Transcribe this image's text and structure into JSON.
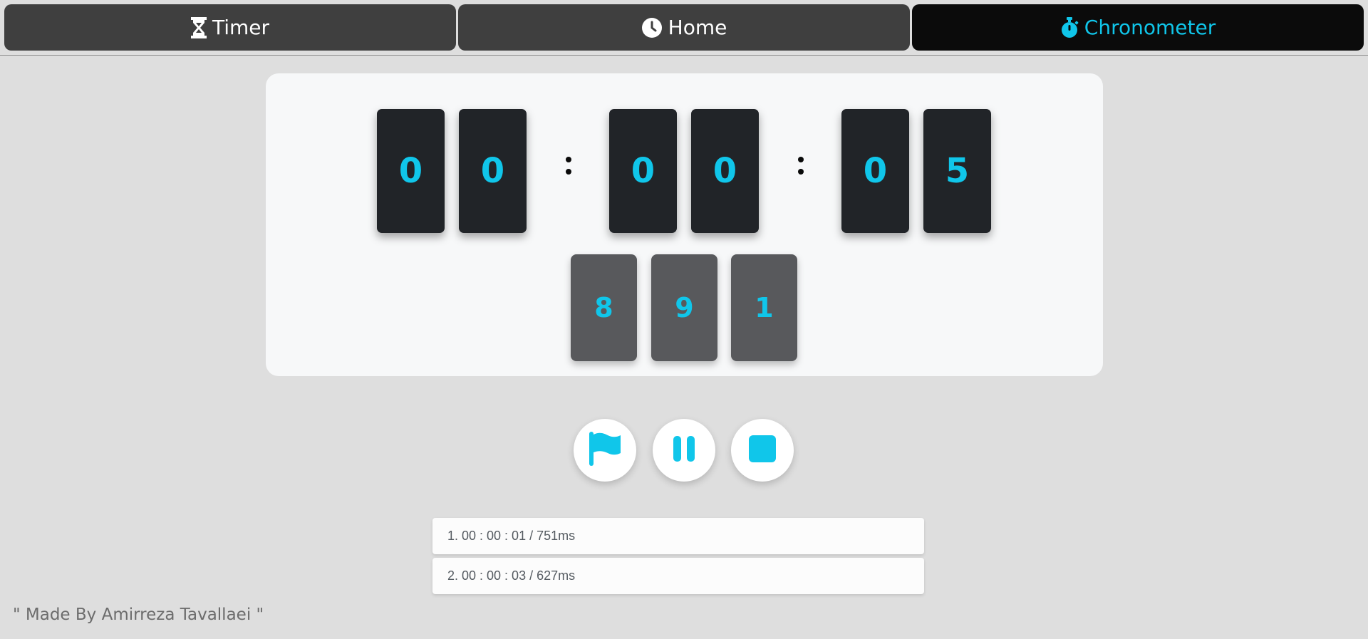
{
  "nav": {
    "tabs": [
      {
        "label": "Timer",
        "icon": "hourglass-icon",
        "active": false
      },
      {
        "label": "Home",
        "icon": "clock-icon",
        "active": false
      },
      {
        "label": "Chronometer",
        "icon": "stopwatch-icon",
        "active": true
      }
    ]
  },
  "display": {
    "hours": [
      "0",
      "0"
    ],
    "minutes": [
      "0",
      "0"
    ],
    "seconds": [
      "0",
      "5"
    ],
    "milliseconds": [
      "8",
      "9",
      "1"
    ]
  },
  "controls": [
    {
      "name": "lap-button",
      "icon": "flag-icon"
    },
    {
      "name": "pause-button",
      "icon": "pause-icon"
    },
    {
      "name": "stop-button",
      "icon": "stop-icon"
    }
  ],
  "laps": [
    "1. 00 : 00 : 01 / 751ms",
    "2. 00 : 00 : 03 / 627ms"
  ],
  "footer": {
    "credit": "\" Made By Amirreza Tavallaei \""
  },
  "colors": {
    "accent": "#10c6ea",
    "tab_bg": "#3f3f3f",
    "tab_active_bg": "#0b0b0b",
    "digit_bg": "#212428",
    "ms_bg": "#58595c",
    "page_bg": "#dedede"
  }
}
